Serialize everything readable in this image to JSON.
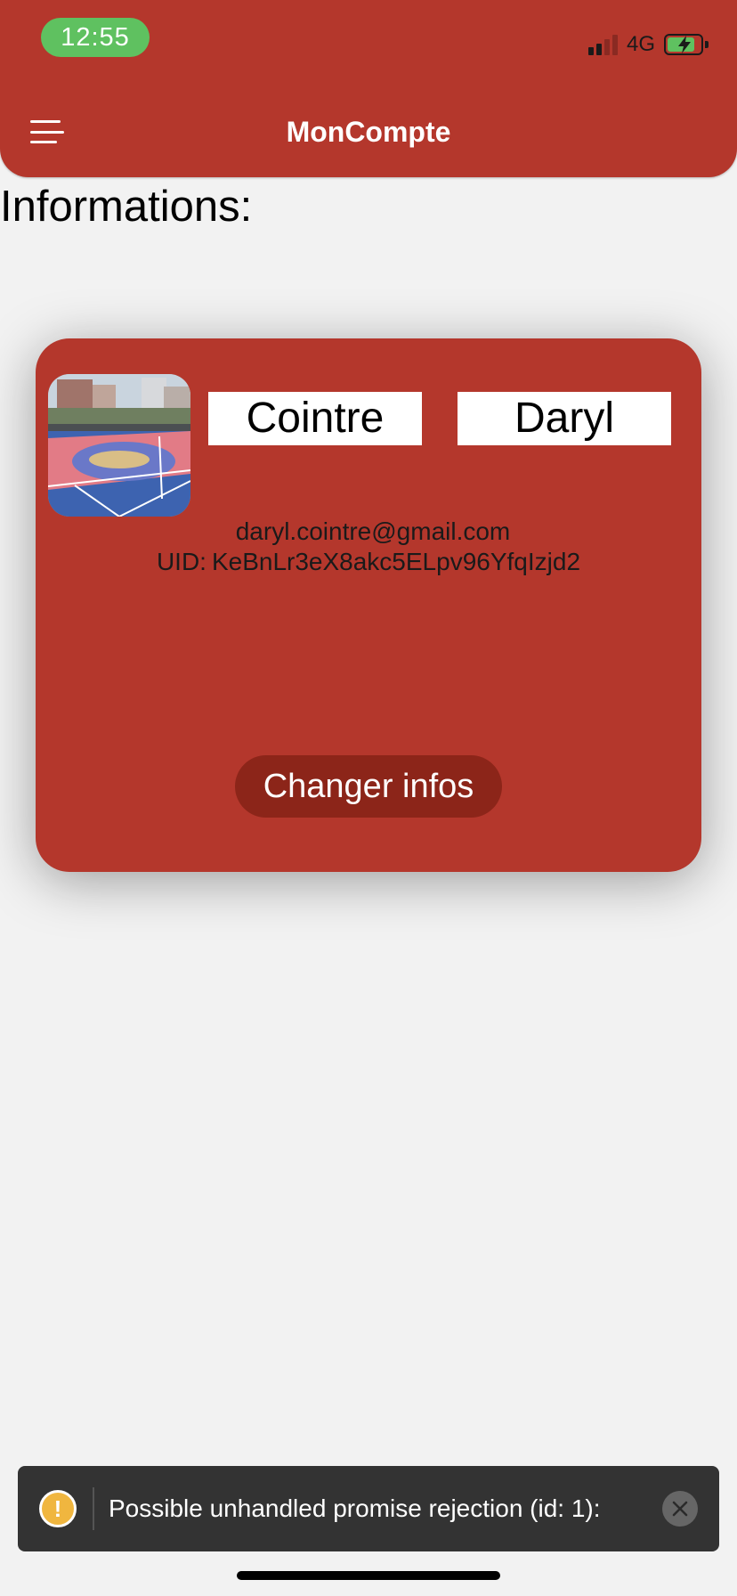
{
  "status_bar": {
    "time": "12:55",
    "network": "4G",
    "signal_bars_active": 2,
    "signal_bars_total": 4,
    "battery_state": "charging",
    "time_pill_color": "#5fc160"
  },
  "header": {
    "title": "MonCompte",
    "menu_icon": "hamburger-menu-icon",
    "background_color": "#b4372c"
  },
  "section": {
    "title": "Informations:"
  },
  "profile": {
    "avatar_description": "basketball-court-photo",
    "last_name": "Cointre",
    "first_name": "Daryl",
    "email": "daryl.cointre@gmail.com",
    "uid_label": "UID:",
    "uid_value": "KeBnLr3eX8akc5ELpv96YfqIzjd2",
    "change_button_label": "Changer infos",
    "card_color": "#b4372c",
    "button_color": "#8c2519"
  },
  "toast": {
    "icon": "warning-icon",
    "message": "Possible unhandled promise rejection (id: 1):",
    "close_icon": "close-icon"
  }
}
